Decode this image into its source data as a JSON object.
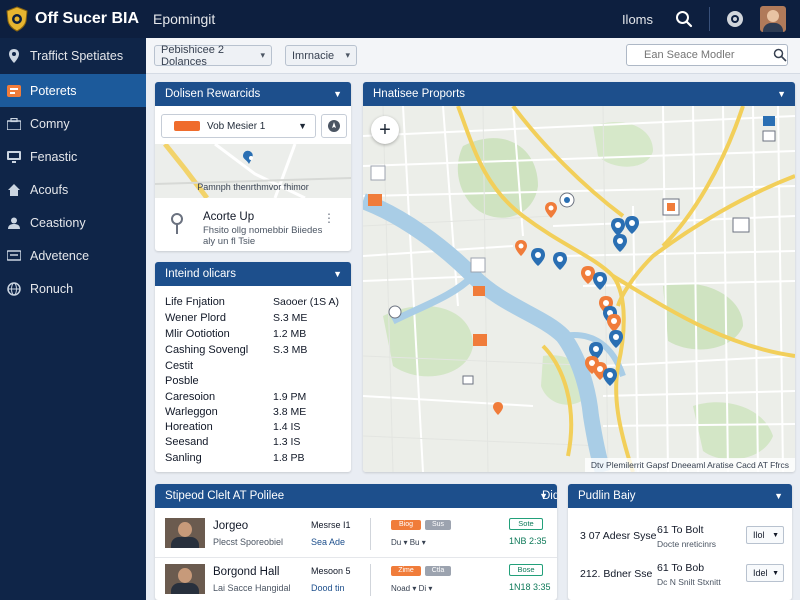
{
  "app": {
    "title": "Off Sucer BIA",
    "subtitle": "Epomingit",
    "top_link": "Iloms"
  },
  "sidebar": {
    "header": "Traffict Spetiates",
    "items": [
      {
        "label": "Poterets",
        "icon": "report-icon",
        "active": true
      },
      {
        "label": "Comny",
        "icon": "briefcase-icon",
        "active": false
      },
      {
        "label": "Fenastic",
        "icon": "monitor-icon",
        "active": false
      },
      {
        "label": "Acoufs",
        "icon": "home-icon",
        "active": false
      },
      {
        "label": "Ceastiony",
        "icon": "user-icon",
        "active": false
      },
      {
        "label": "Advetence",
        "icon": "display-icon",
        "active": false
      },
      {
        "label": "Ronuch",
        "icon": "globe-icon",
        "active": false
      }
    ]
  },
  "filters": {
    "select1": "Pebishicee 2 Dolances",
    "select2": "Imrnacie",
    "search_placeholder": "Ean Seace Modler"
  },
  "location_panel": {
    "title": "Dolisen Rewarcids",
    "select_value": "Vob Mesier 1",
    "map_caption": "Pamnph thenrthmvor fhimor",
    "item_title": "Acorte Up",
    "item_sub": "Fhsito ollg nomebbir Biiedes aly un fl Tsie"
  },
  "info_panel": {
    "title": "Inteind olicars",
    "rows": [
      {
        "label": "Life Fnjation",
        "value": "Saooer (1S A)"
      },
      {
        "label": "Wener Plord",
        "value": "S.3 ME"
      },
      {
        "label": "Mlir Ootiotion",
        "value": "1.2 MB"
      },
      {
        "label": "Cashing Sovengl",
        "value": "S.3 MB"
      },
      {
        "label": "Cestit",
        "value": ""
      },
      {
        "label": "Posble",
        "value": ""
      },
      {
        "label": "Caresoion",
        "value": "1.9 PM"
      },
      {
        "label": "Warleggon",
        "value": "3.8 ME"
      },
      {
        "label": "Horeation",
        "value": "1.4 IS"
      },
      {
        "label": "Seesand",
        "value": "1.3 IS"
      },
      {
        "label": "Sanling",
        "value": "1.8 PB"
      }
    ]
  },
  "map_panel": {
    "title": "Hnatisee Proports",
    "attribution": "Dtv Plemilerrit  Gapsf Dneeaml Aratise   Cacd   AT Ffrcs"
  },
  "staff_panel": {
    "title": "Stipeod Clelt AT Polilee",
    "col_title": "Didicellations",
    "rows": [
      {
        "name": "Jorgeo",
        "sub": "Plecst Sporeobiel",
        "col1": "Mesrse I1",
        "col2": "Sea Ade",
        "tag1": "Biog",
        "tag2": "Sus",
        "tag_caption": "Du   ▾   Bu   ▾",
        "status": "Sote",
        "status_val": "1NB 2:35"
      },
      {
        "name": "Borgond Hall",
        "sub": "Lai Sacce Hangidal",
        "col1": "Mesoon 5",
        "col2": "Dood tin",
        "tag1": "Zime",
        "tag2": "Ctla",
        "tag_caption": "Noad   ▾   Di   ▾",
        "status": "Bose",
        "status_val": "1N18 3:35"
      }
    ]
  },
  "pub_panel": {
    "title": "Pudlin Baiy",
    "rows": [
      {
        "left": "3 07 Adesr Syse",
        "mid": "61 To Bolt",
        "midsub": "Docte nreticinrs",
        "select": "Ilol"
      },
      {
        "left": "212. Bdner Sse",
        "mid": "61 To Bob",
        "midsub": "Dc N Snilt Stxnitt",
        "select": "Idel"
      }
    ]
  },
  "colors": {
    "topbar": "#0d1f3f",
    "sidebar": "#0f2548",
    "accent": "#1d4f8c",
    "active_item": "#1c5a9b",
    "marker_orange": "#f07c3a",
    "marker_blue": "#2a6fb3"
  }
}
